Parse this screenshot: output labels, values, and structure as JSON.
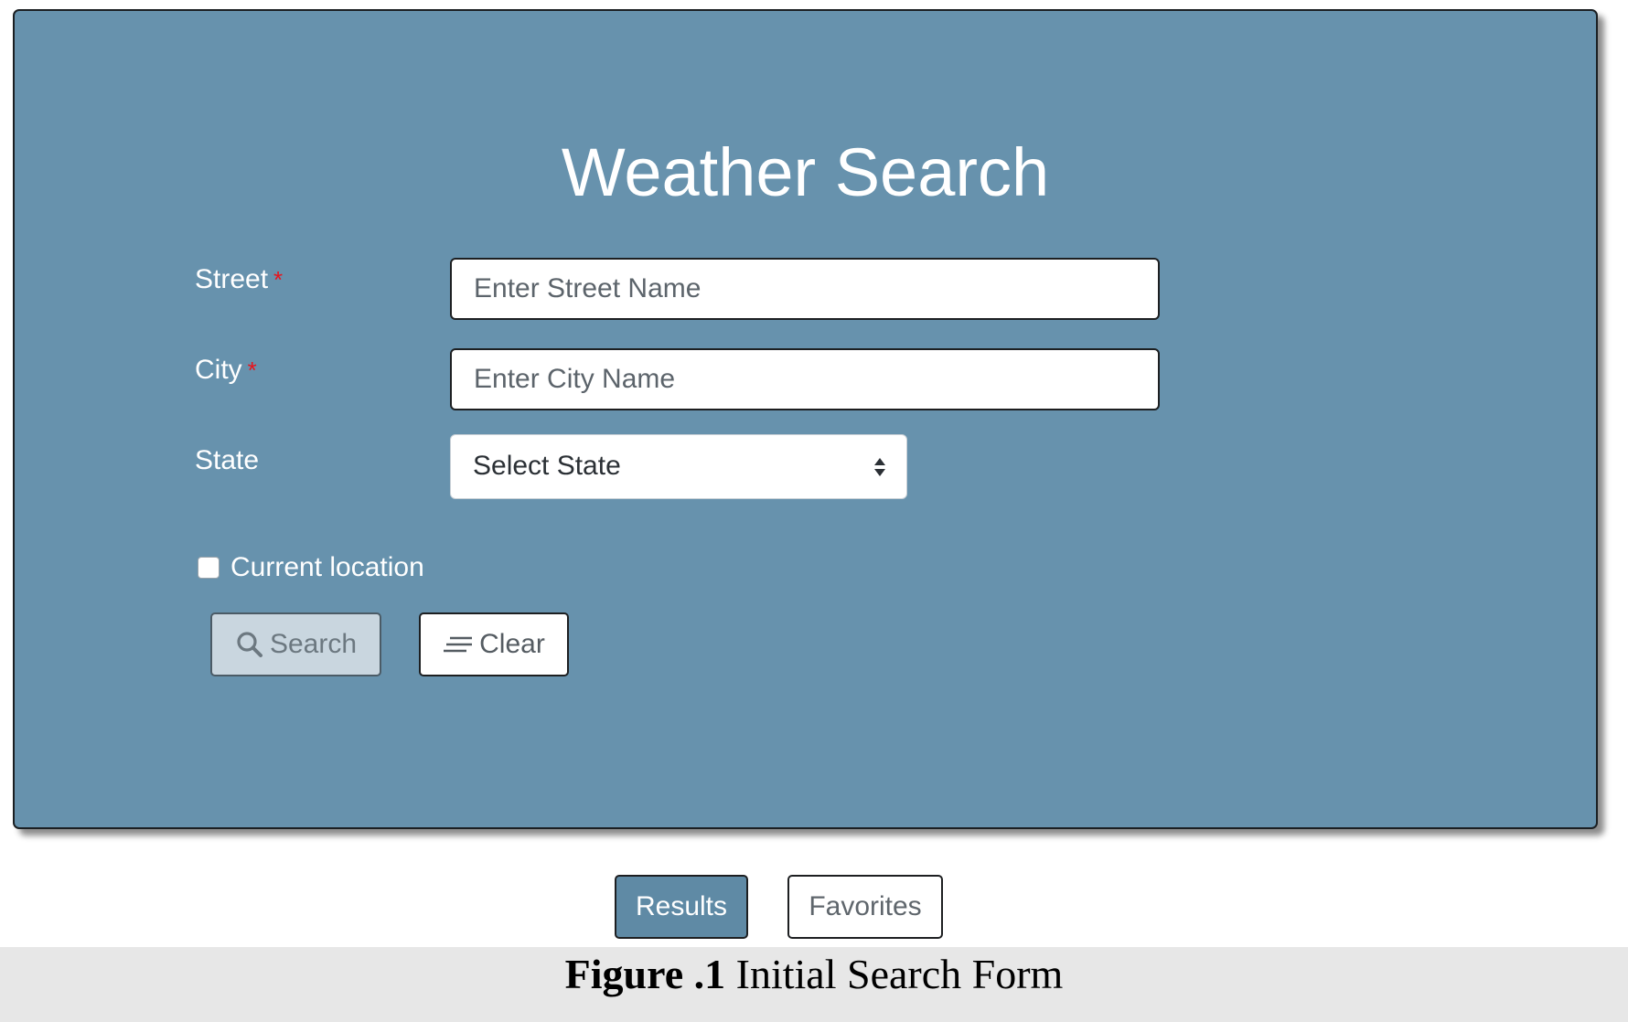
{
  "form": {
    "title": "Weather Search",
    "street": {
      "label": "Street",
      "required_mark": "*",
      "placeholder": "Enter Street Name",
      "value": ""
    },
    "city": {
      "label": "City",
      "required_mark": "*",
      "placeholder": "Enter City Name",
      "value": ""
    },
    "state": {
      "label": "State",
      "selected": "Select State"
    },
    "current_location": {
      "label": "Current location",
      "checked": false
    },
    "buttons": {
      "search_label": "Search",
      "search_icon": "search-icon",
      "clear_label": "Clear",
      "clear_icon": "clear-lines-icon"
    }
  },
  "view_toggle": {
    "results_label": "Results",
    "favorites_label": "Favorites"
  },
  "caption": {
    "prefix": "Figure .1",
    "text": " Initial Search Form"
  },
  "colors": {
    "panel_bg": "#6792ad",
    "required": "#e8141c",
    "results_bg": "#5f8aa5"
  }
}
